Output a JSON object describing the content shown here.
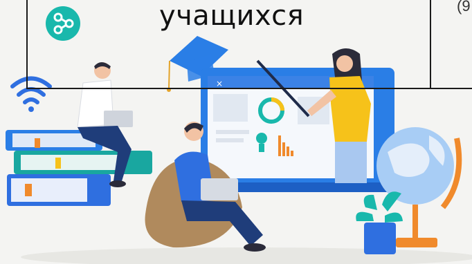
{
  "header": {
    "word": "учащихся",
    "cut_text": "(9"
  },
  "icons": {
    "share": "share-icon",
    "wifi": "wifi-icon"
  },
  "colors": {
    "teal": "#19b8ac",
    "blue": "#2f6fe0",
    "yellow": "#f6c21a",
    "screen_frame": "#3b82e6"
  }
}
